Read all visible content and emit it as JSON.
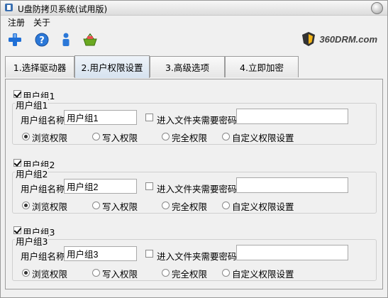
{
  "window": {
    "title": "U盘防拷贝系统(试用版)"
  },
  "menu": [
    "注册",
    "关于"
  ],
  "toolbar": {
    "icons": [
      "add-icon",
      "help-icon",
      "user-icon",
      "basket-icon"
    ]
  },
  "logo": {
    "text": "360DRM.com"
  },
  "tabs": [
    "1.选择驱动器",
    "2.用户权限设置",
    "3.高级选项",
    "4.立即加密"
  ],
  "active_tab": 1,
  "groups": [
    {
      "checkbox_label": "用户组1",
      "legend": "用户组1",
      "name_label": "用户组名称",
      "name_value": "用户组1",
      "password_label": "进入文件夹需要密码",
      "password_value": "",
      "radios": [
        "浏览权限",
        "写入权限",
        "完全权限",
        "自定义权限设置"
      ],
      "selected": 0
    },
    {
      "checkbox_label": "用户组2",
      "legend": "用户组2",
      "name_label": "用户组名称",
      "name_value": "用户组2",
      "password_label": "进入文件夹需要密码",
      "password_value": "",
      "radios": [
        "浏览权限",
        "写入权限",
        "完全权限",
        "自定义权限设置"
      ],
      "selected": 0
    },
    {
      "checkbox_label": "用户组3",
      "legend": "用户组3",
      "name_label": "用户组名称",
      "name_value": "用户组3",
      "password_label": "进入文件夹需要密码",
      "password_value": "",
      "radios": [
        "浏览权限",
        "写入权限",
        "完全权限",
        "自定义权限设置"
      ],
      "selected": 0
    }
  ],
  "colors": {
    "accent": "#1f6fd6",
    "help": "#2b78d8",
    "basket": "#6aa821"
  }
}
